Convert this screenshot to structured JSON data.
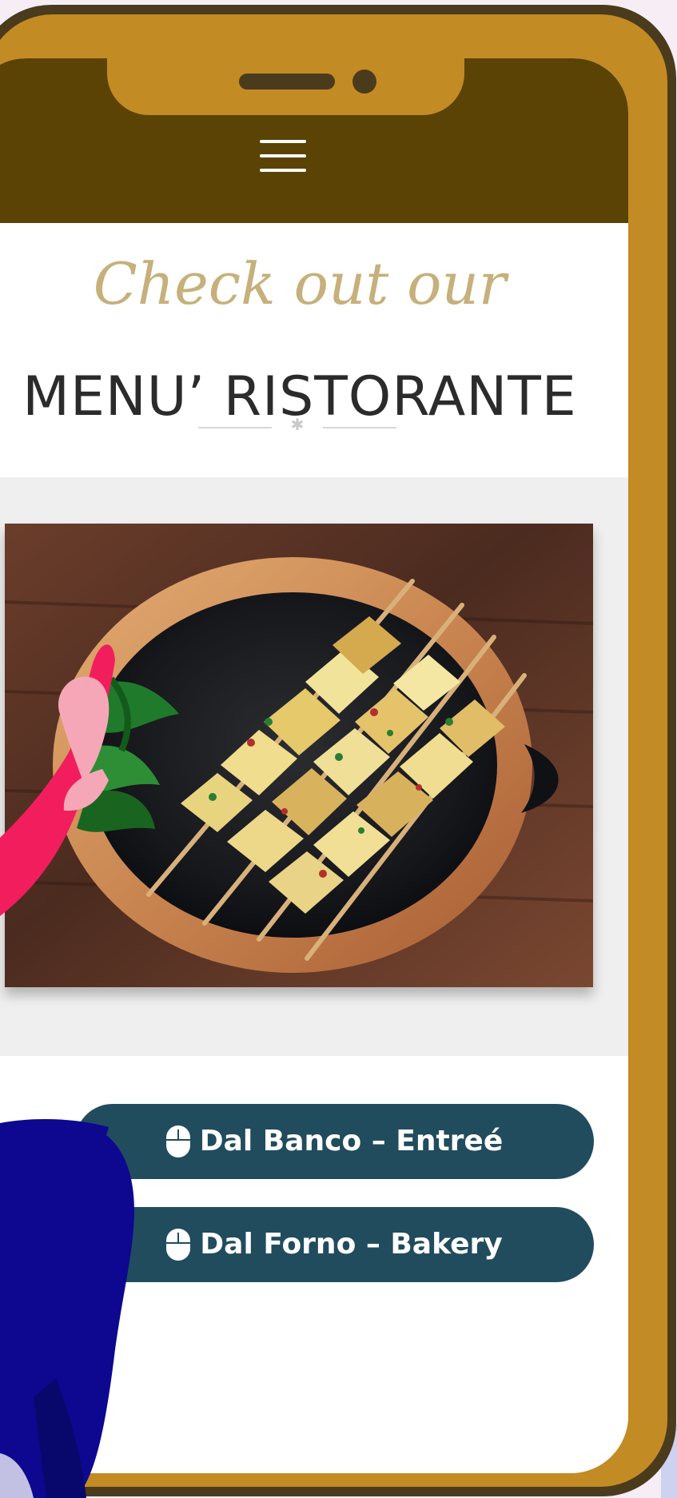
{
  "header": {
    "menu_icon": "hamburger-icon"
  },
  "hero": {
    "script_heading": "Check out our",
    "title": "MENU’ RISTORANTE",
    "divider_icon": "asterisk-icon"
  },
  "gallery": {
    "image_name": "chicken-skewers-food-photo"
  },
  "menu_buttons": [
    {
      "label": "Dal Banco – Entreé",
      "icon": "mouse-icon"
    },
    {
      "label": "Dal Forno – Bakery",
      "icon": "mouse-icon"
    }
  ],
  "colors": {
    "header": "#5a4304",
    "phone_frame": "#c38b23",
    "script_heading": "#c6b07b",
    "title": "#2b2b2b",
    "button": "#214c5e",
    "button_text": "#ffffff",
    "section_background": "#efefef"
  }
}
